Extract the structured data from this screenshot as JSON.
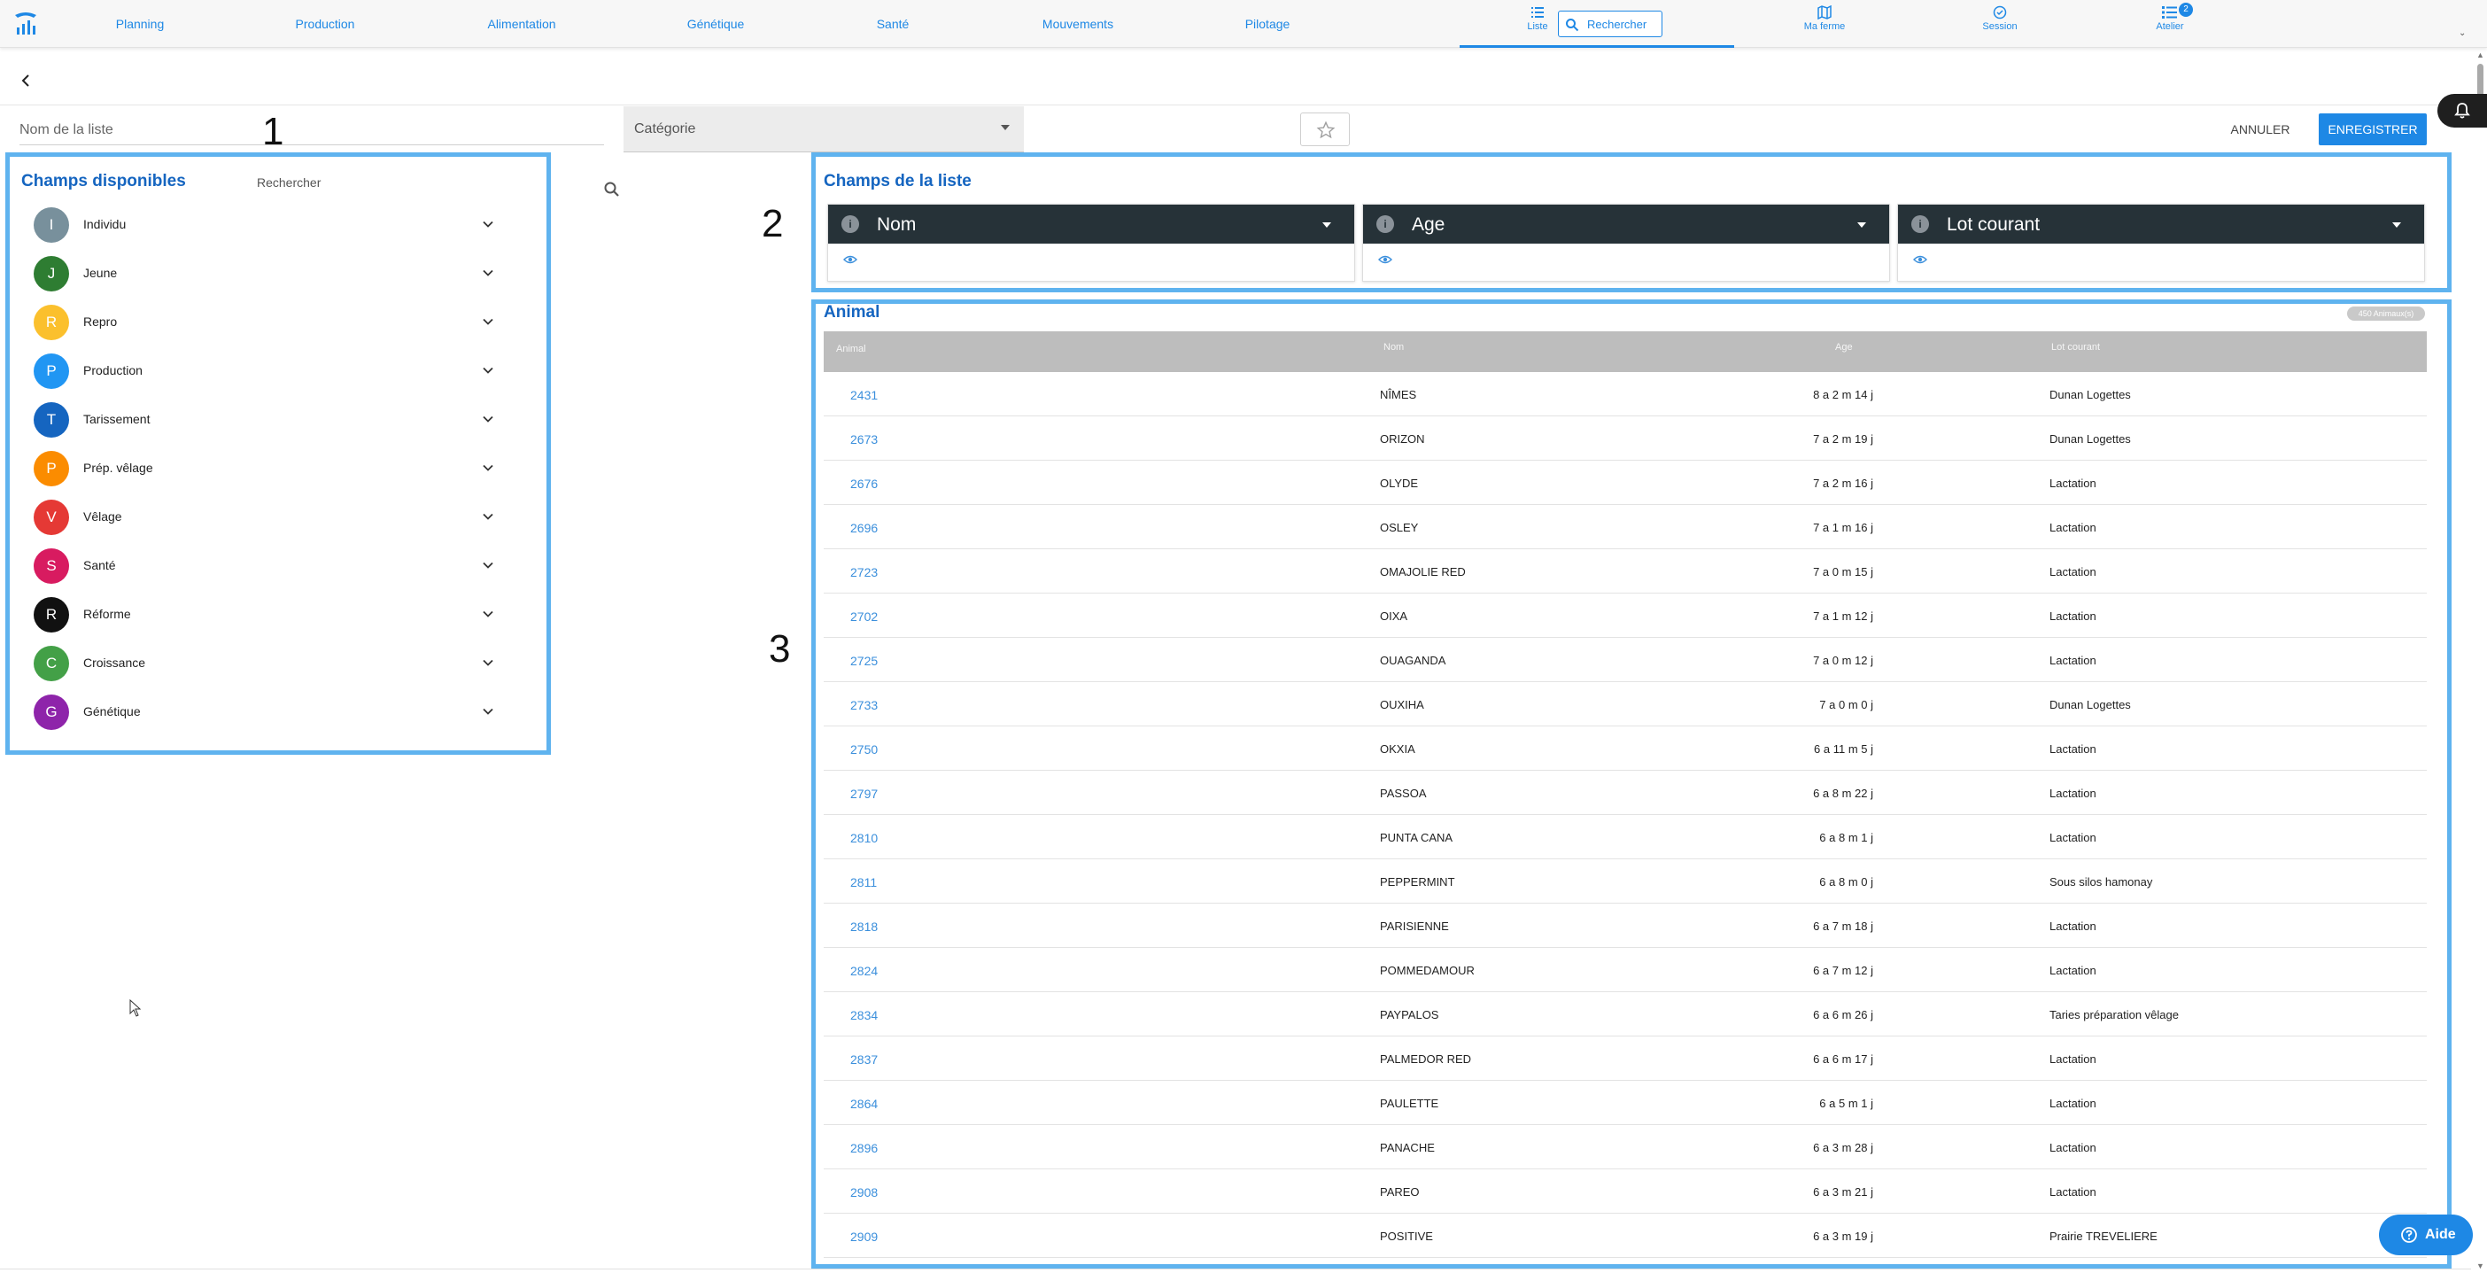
{
  "nav": {
    "items": [
      "Planning",
      "Production",
      "Alimentation",
      "Génétique",
      "Santé",
      "Mouvements",
      "Pilotage"
    ],
    "liste_label": "Liste",
    "search_placeholder": "Rechercher",
    "ma_ferme_label": "Ma ferme",
    "session_label": "Session",
    "atelier_label": "Atelier",
    "atelier_badge": "2"
  },
  "form": {
    "name_placeholder": "Nom de la liste",
    "category_placeholder": "Catégorie",
    "cancel_label": "ANNULER",
    "save_label": "ENREGISTRER"
  },
  "steps": [
    "1",
    "2",
    "3"
  ],
  "available": {
    "title": "Champs disponibles",
    "search_placeholder": "Rechercher",
    "categories": [
      {
        "letter": "I",
        "label": "Individu",
        "color": "#78909c"
      },
      {
        "letter": "J",
        "label": "Jeune",
        "color": "#2e7d32"
      },
      {
        "letter": "R",
        "label": "Repro",
        "color": "#fbc02d"
      },
      {
        "letter": "P",
        "label": "Production",
        "color": "#2196f3"
      },
      {
        "letter": "T",
        "label": "Tarissement",
        "color": "#1565c0"
      },
      {
        "letter": "P",
        "label": "Prép. vêlage",
        "color": "#fb8c00"
      },
      {
        "letter": "V",
        "label": "Vêlage",
        "color": "#e53935"
      },
      {
        "letter": "S",
        "label": "Santé",
        "color": "#d81b60"
      },
      {
        "letter": "R",
        "label": "Réforme",
        "color": "#111111"
      },
      {
        "letter": "C",
        "label": "Croissance",
        "color": "#43a047"
      },
      {
        "letter": "G",
        "label": "Génétique",
        "color": "#8e24aa"
      }
    ]
  },
  "list_fields": {
    "title": "Champs de la liste",
    "fields": [
      {
        "info": "i",
        "label": "Nom"
      },
      {
        "info": "i",
        "label": "Age"
      },
      {
        "info": "i",
        "label": "Lot courant"
      }
    ]
  },
  "preview": {
    "title": "Animal",
    "count_badge": "450 Animaux(s)",
    "columns": [
      "Animal",
      "Nom",
      "Age",
      "Lot courant"
    ],
    "rows": [
      [
        "2431",
        "NÎMES",
        "8 a 2 m 14 j",
        "Dunan Logettes"
      ],
      [
        "2673",
        "ORIZON",
        "7 a 2 m 19 j",
        "Dunan Logettes"
      ],
      [
        "2676",
        "OLYDE",
        "7 a 2 m 16 j",
        "Lactation"
      ],
      [
        "2696",
        "OSLEY",
        "7 a 1 m 16 j",
        "Lactation"
      ],
      [
        "2723",
        "OMAJOLIE RED",
        "7 a 0 m 15 j",
        "Lactation"
      ],
      [
        "2702",
        "OIXA",
        "7 a 1 m 12 j",
        "Lactation"
      ],
      [
        "2725",
        "OUAGANDA",
        "7 a 0 m 12 j",
        "Lactation"
      ],
      [
        "2733",
        "OUXIHA",
        "7 a 0 m 0 j",
        "Dunan Logettes"
      ],
      [
        "2750",
        "OKXIA",
        "6 a 11 m 5 j",
        "Lactation"
      ],
      [
        "2797",
        "PASSOA",
        "6 a 8 m 22 j",
        "Lactation"
      ],
      [
        "2810",
        "PUNTA CANA",
        "6 a 8 m 1 j",
        "Lactation"
      ],
      [
        "2811",
        "PEPPERMINT",
        "6 a 8 m 0 j",
        "Sous silos hamonay"
      ],
      [
        "2818",
        "PARISIENNE",
        "6 a 7 m 18 j",
        "Lactation"
      ],
      [
        "2824",
        "POMMEDAMOUR",
        "6 a 7 m 12 j",
        "Lactation"
      ],
      [
        "2834",
        "PAYPALOS",
        "6 a 6 m 26 j",
        "Taries préparation vêlage"
      ],
      [
        "2837",
        "PALMEDOR RED",
        "6 a 6 m 17 j",
        "Lactation"
      ],
      [
        "2864",
        "PAULETTE",
        "6 a 5 m 1 j",
        "Lactation"
      ],
      [
        "2896",
        "PANACHE",
        "6 a 3 m 28 j",
        "Lactation"
      ],
      [
        "2908",
        "PAREO",
        "6 a 3 m 21 j",
        "Lactation"
      ],
      [
        "2909",
        "POSITIVE",
        "6 a 3 m 19 j",
        "Prairie TREVELIERE"
      ]
    ]
  },
  "help": {
    "label": "Aide"
  },
  "colors": {
    "accent": "#1e88e5",
    "highlight": "#5fb3ef",
    "title_blue": "#1565c0",
    "header_dark": "#263238"
  }
}
